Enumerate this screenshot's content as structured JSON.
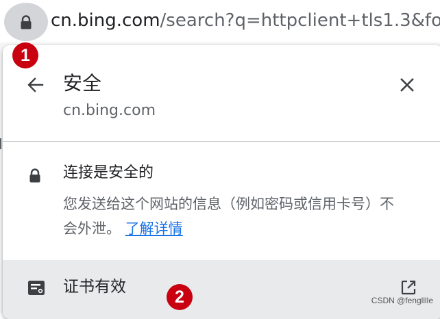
{
  "address_bar": {
    "host": "cn.bing.com",
    "path": "/search?q=httpclient+tls1.3&fo"
  },
  "popup": {
    "title": "安全",
    "subtitle": "cn.bing.com",
    "connection": {
      "title": "连接是安全的",
      "description": "您发送给这个网站的信息（例如密码或信用卡号）不会外泄。",
      "link": "了解详情"
    },
    "certificate": {
      "label": "证书有效"
    }
  },
  "markers": [
    "1",
    "2"
  ],
  "watermark": "CSDN @fenglllle",
  "colors": {
    "link": "#1a73e8",
    "marker": "#c8000f",
    "lock_button_bg": "#d3d5d9",
    "cert_row_bg": "#e9eaeb"
  },
  "icons": {
    "lock": "lock-icon",
    "back": "arrow-back-icon",
    "close": "close-icon",
    "certificate": "certificate-icon",
    "external": "open-in-new-icon"
  }
}
